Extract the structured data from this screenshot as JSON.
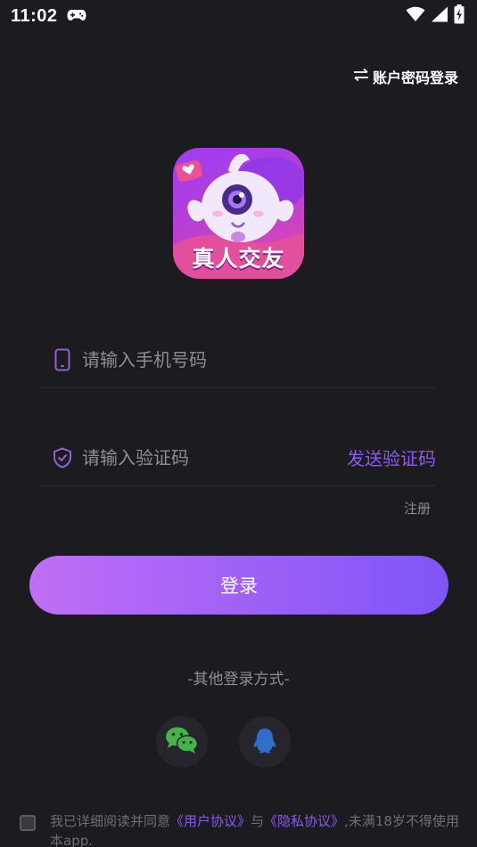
{
  "status_bar": {
    "time": "11:02",
    "icons": [
      "gamepad-icon",
      "wifi-icon",
      "signal-icon",
      "battery-charging-icon"
    ]
  },
  "header": {
    "switch_login_label": "账户密码登录",
    "switch_icon": "swap-arrows-icon"
  },
  "logo": {
    "text": "真人交友"
  },
  "form": {
    "phone_placeholder": "请输入手机号码",
    "phone_value": "",
    "code_placeholder": "请输入验证码",
    "code_value": "",
    "send_code_label": "发送验证码",
    "register_label": "注册",
    "login_label": "登录"
  },
  "other_login": {
    "title": "-其他登录方式-",
    "methods": [
      "wechat-icon",
      "qq-icon"
    ]
  },
  "agreement": {
    "prefix": "我已详细阅读并同意",
    "user_agreement": "《用户协议》",
    "conjunction": "与",
    "privacy_policy": "《隐私协议》",
    "suffix": ",未满18岁不得使用本app.",
    "checked": false
  },
  "colors": {
    "background": "#1c1b20",
    "accent": "#8d58f2",
    "button_gradient_start": "#c06ef5",
    "button_gradient_end": "#7f55f7",
    "muted_text": "#8e8d93"
  }
}
